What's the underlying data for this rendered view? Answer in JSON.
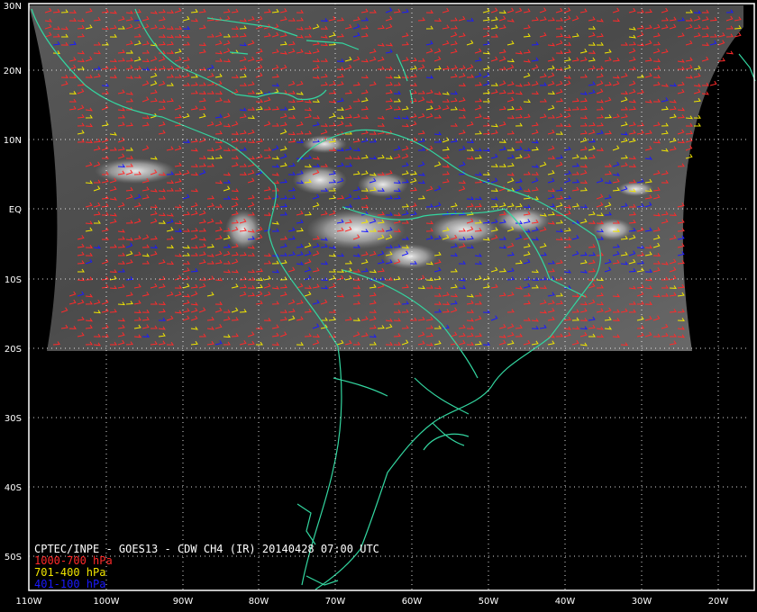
{
  "map": {
    "title": "CPTEC/INPE - GOES13 - CDW CH4 (IR) 20140428 07:00 UTC",
    "legend": [
      {
        "label": "1000-700 hPa",
        "color": "#ff2a2a"
      },
      {
        "label": "701-400 hPa",
        "color": "#f2e600"
      },
      {
        "label": "401-100 hPa",
        "color": "#1a1aff"
      }
    ],
    "lat_labels": [
      "30N",
      "20N",
      "10N",
      "EQ",
      "10S",
      "20S",
      "30S",
      "40S",
      "50S"
    ],
    "lon_labels": [
      "110W",
      "100W",
      "90W",
      "80W",
      "70W",
      "60W",
      "50W",
      "40W",
      "30W",
      "20W"
    ],
    "colors": {
      "background": "#000000",
      "coastline": "#33d6a0",
      "grid": "#ffffff",
      "frame": "#ffffff"
    }
  }
}
